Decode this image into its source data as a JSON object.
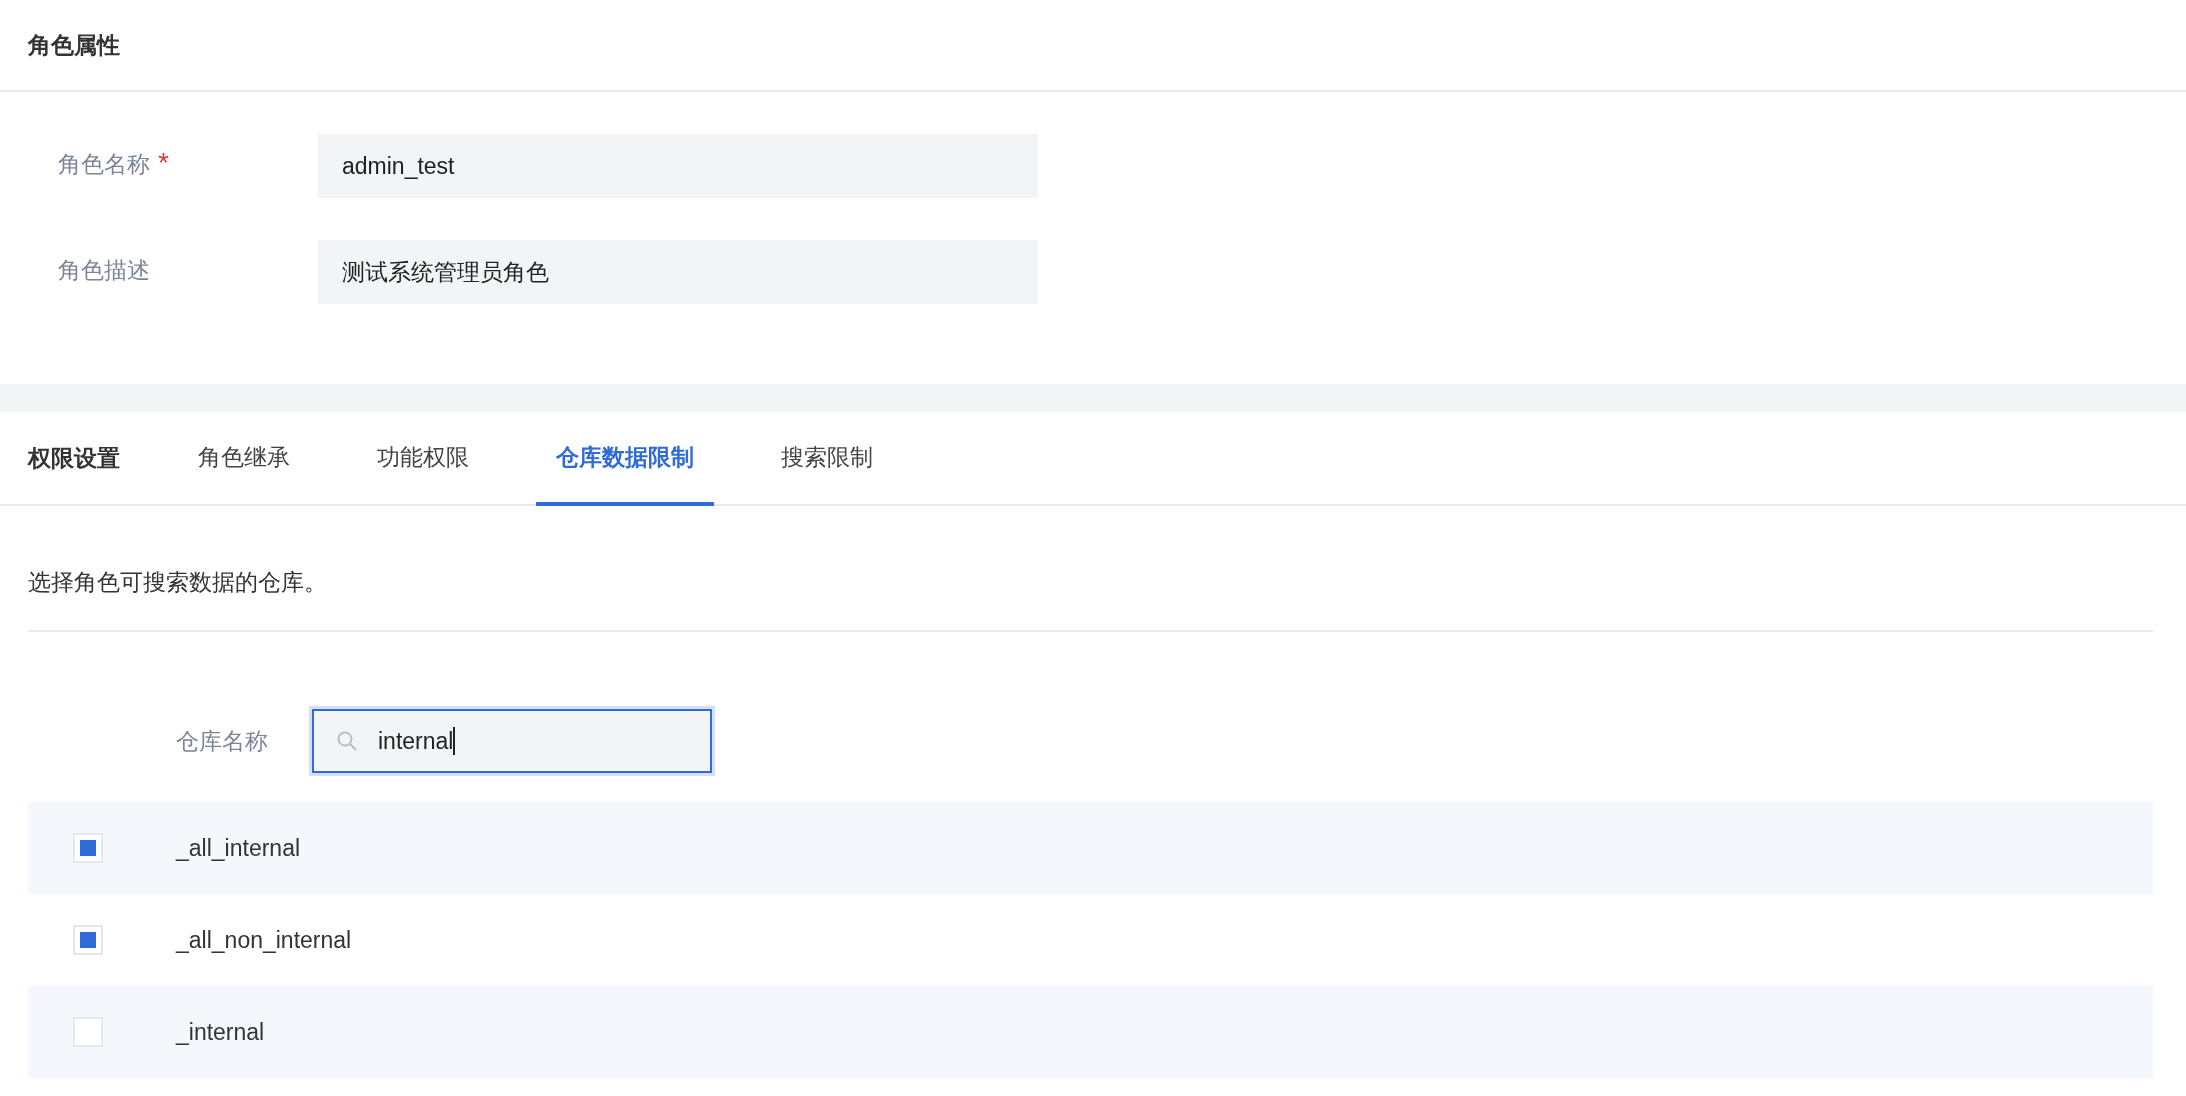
{
  "section": {
    "title": "角色属性"
  },
  "fields": [
    {
      "label": "角色名称",
      "required_mark": "*",
      "value": "admin_test"
    },
    {
      "label": "角色描述",
      "value": "测试系统管理员角色"
    }
  ],
  "permissions": {
    "title": "权限设置",
    "tabs": [
      {
        "label": "角色继承",
        "selected": false
      },
      {
        "label": "功能权限",
        "selected": false
      },
      {
        "label": "仓库数据限制",
        "selected": true
      },
      {
        "label": "搜索限制",
        "selected": false
      }
    ],
    "description": "选择角色可搜索数据的仓库。",
    "search": {
      "label": "仓库名称",
      "value": "internal",
      "focused": true
    },
    "warehouses": [
      {
        "name": "_all_internal",
        "checked": true
      },
      {
        "name": "_all_non_internal",
        "checked": true
      },
      {
        "name": "_internal",
        "checked": false
      }
    ]
  }
}
